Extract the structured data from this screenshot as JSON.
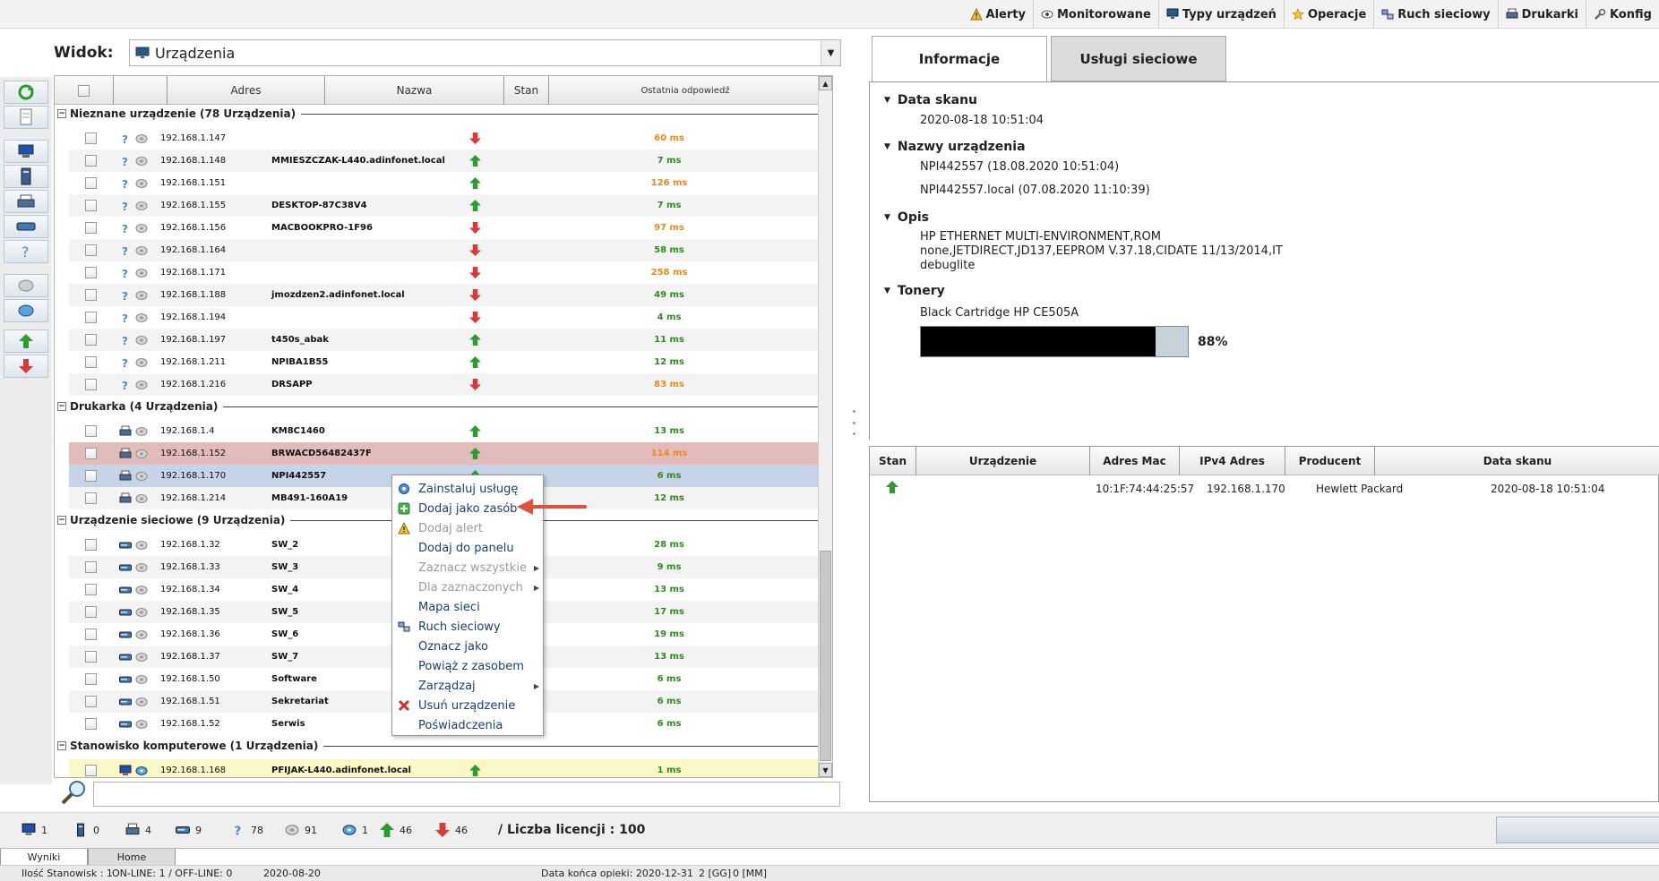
{
  "top_menu": [
    {
      "label": "Alerty",
      "icon": "warning-icon"
    },
    {
      "label": "Monitorowane",
      "icon": "eye-icon"
    },
    {
      "label": "Typy urządzeń",
      "icon": "monitor-icon"
    },
    {
      "label": "Operacje",
      "icon": "star-icon"
    },
    {
      "label": "Ruch sieciowy",
      "icon": "network-traffic-icon"
    },
    {
      "label": "Drukarki",
      "icon": "printer-icon"
    },
    {
      "label": "Konfig",
      "icon": "wrench-icon"
    }
  ],
  "view": {
    "label": "Widok:",
    "selected": "Urządzenia"
  },
  "grid": {
    "columns": {
      "address": "Adres",
      "name": "Nazwa",
      "status": "Stan",
      "last_response": "Ostatnia odpowiedź"
    },
    "groups": [
      {
        "title": "Nieznane urządzenie (78 Urządzenia)",
        "rows": [
          {
            "ip": "192.168.1.147",
            "name": "",
            "status": "down",
            "ms": "60 ms",
            "ms_color": "orange"
          },
          {
            "ip": "192.168.1.148",
            "name": "MMIESZCZAK-L440.adinfonet.local",
            "status": "up",
            "ms": "7 ms",
            "ms_color": "green"
          },
          {
            "ip": "192.168.1.151",
            "name": "",
            "status": "up",
            "ms": "126 ms",
            "ms_color": "orange"
          },
          {
            "ip": "192.168.1.155",
            "name": "DESKTOP-87C38V4",
            "status": "up",
            "ms": "7 ms",
            "ms_color": "green"
          },
          {
            "ip": "192.168.1.156",
            "name": "MACBOOKPRO-1F96",
            "status": "down",
            "ms": "97 ms",
            "ms_color": "orange"
          },
          {
            "ip": "192.168.1.164",
            "name": "",
            "status": "down",
            "ms": "58 ms",
            "ms_color": "green"
          },
          {
            "ip": "192.168.1.171",
            "name": "",
            "status": "down",
            "ms": "258 ms",
            "ms_color": "orange"
          },
          {
            "ip": "192.168.1.188",
            "name": "jmozdzen2.adinfonet.local",
            "status": "down",
            "ms": "49 ms",
            "ms_color": "green"
          },
          {
            "ip": "192.168.1.194",
            "name": "",
            "status": "down",
            "ms": "4 ms",
            "ms_color": "green"
          },
          {
            "ip": "192.168.1.197",
            "name": "t450s_abak",
            "status": "up",
            "ms": "11 ms",
            "ms_color": "green"
          },
          {
            "ip": "192.168.1.211",
            "name": "NPIBA1B55",
            "status": "up",
            "ms": "12 ms",
            "ms_color": "green"
          },
          {
            "ip": "192.168.1.216",
            "name": "DRSAPP",
            "status": "down",
            "ms": "83 ms",
            "ms_color": "orange"
          }
        ]
      },
      {
        "title": "Drukarka (4 Urządzenia)",
        "rows": [
          {
            "ip": "192.168.1.4",
            "name": "KM8C1460",
            "status": "up",
            "ms": "13 ms",
            "ms_color": "green"
          },
          {
            "ip": "192.168.1.152",
            "name": "BRWACD56482437F",
            "status": "up",
            "ms": "114 ms",
            "ms_color": "orange",
            "highlight": "red"
          },
          {
            "ip": "192.168.1.170",
            "name": "NPI442557",
            "status": "up",
            "ms": "6 ms",
            "ms_color": "green",
            "highlight": "blue"
          },
          {
            "ip": "192.168.1.214",
            "name": "MB491-160A19",
            "status": "up",
            "ms": "12 ms",
            "ms_color": "green"
          }
        ]
      },
      {
        "title": "Urządzenie sieciowe (9 Urządzenia)",
        "rows": [
          {
            "ip": "192.168.1.32",
            "name": "SW_2",
            "status": "",
            "ms": "28 ms",
            "ms_color": "green"
          },
          {
            "ip": "192.168.1.33",
            "name": "SW_3",
            "status": "",
            "ms": "9 ms",
            "ms_color": "green"
          },
          {
            "ip": "192.168.1.34",
            "name": "SW_4",
            "status": "",
            "ms": "13 ms",
            "ms_color": "green"
          },
          {
            "ip": "192.168.1.35",
            "name": "SW_5",
            "status": "",
            "ms": "17 ms",
            "ms_color": "green"
          },
          {
            "ip": "192.168.1.36",
            "name": "SW_6",
            "status": "",
            "ms": "19 ms",
            "ms_color": "green"
          },
          {
            "ip": "192.168.1.37",
            "name": "SW_7",
            "status": "",
            "ms": "13 ms",
            "ms_color": "green"
          },
          {
            "ip": "192.168.1.50",
            "name": "Software",
            "status": "",
            "ms": "6 ms",
            "ms_color": "green"
          },
          {
            "ip": "192.168.1.51",
            "name": "Sekretariat",
            "status": "",
            "ms": "6 ms",
            "ms_color": "green"
          },
          {
            "ip": "192.168.1.52",
            "name": "Serwis",
            "status": "",
            "ms": "6 ms",
            "ms_color": "green"
          }
        ]
      },
      {
        "title": "Stanowisko komputerowe (1 Urządzenia)",
        "rows": [
          {
            "ip": "192.168.1.168",
            "name": "PFIJAK-L440.adinfonet.local",
            "status": "up",
            "ms": "1 ms",
            "ms_color": "green",
            "highlight": "yellow"
          }
        ]
      }
    ]
  },
  "context_menu": [
    {
      "label": "Zainstaluj usługę",
      "icon": "gear-icon",
      "disabled": false,
      "submenu": false
    },
    {
      "label": "Dodaj jako zasób",
      "icon": "plus-icon",
      "disabled": false,
      "submenu": false
    },
    {
      "label": "Dodaj alert",
      "icon": "warning-icon",
      "disabled": true,
      "submenu": false
    },
    {
      "label": "Dodaj do panelu",
      "icon": "",
      "disabled": false,
      "submenu": false
    },
    {
      "label": "Zaznacz wszystkie",
      "icon": "",
      "disabled": true,
      "submenu": true
    },
    {
      "label": "Dla zaznaczonych",
      "icon": "",
      "disabled": true,
      "submenu": true
    },
    {
      "label": "Mapa sieci",
      "icon": "",
      "disabled": false,
      "submenu": false
    },
    {
      "label": "Ruch sieciowy",
      "icon": "network-traffic-icon",
      "disabled": false,
      "submenu": false
    },
    {
      "label": "Oznacz jako",
      "icon": "",
      "disabled": false,
      "submenu": false
    },
    {
      "label": "Powiąż z zasobem",
      "icon": "",
      "disabled": false,
      "submenu": false
    },
    {
      "label": "Zarządzaj",
      "icon": "",
      "disabled": false,
      "submenu": true
    },
    {
      "label": "Usuń urządzenie",
      "icon": "delete-icon",
      "disabled": false,
      "submenu": false
    },
    {
      "label": "Poświadczenia",
      "icon": "",
      "disabled": false,
      "submenu": false
    }
  ],
  "right_panel": {
    "tabs": [
      "Informacje",
      "Usługi sieciowe"
    ],
    "sections": {
      "scan_date_title": "Data skanu",
      "scan_date": "2020-08-18 10:51:04",
      "names_title": "Nazwy urządzenia",
      "name1": "NPI442557 (18.08.2020 10:51:04)",
      "name2": "NPI442557.local (07.08.2020 11:10:39)",
      "desc_title": "Opis",
      "desc1": "HP ETHERNET MULTI-ENVIRONMENT,ROM",
      "desc2": "none,JETDIRECT,JD137,EEPROM V.37.18,CIDATE 11/13/2014,IT",
      "desc3": "debuglite",
      "toners_title": "Tonery",
      "toner_name": "Black Cartridge HP CE505A",
      "toner_level": 0.88,
      "toner_pct": "88%"
    },
    "history": {
      "columns": [
        "Stan",
        "Urządzenie",
        "Adres Mac",
        "IPv4 Adres",
        "Producent",
        "Data skanu"
      ],
      "row": {
        "status": "up",
        "device": "",
        "mac": "10:1F:74:44:25:57",
        "ip": "192.168.1.170",
        "producer": "Hewlett Packard",
        "date": "2020-08-18 10:51:04"
      }
    }
  },
  "stats": [
    {
      "icon": "computer-icon",
      "value": "1"
    },
    {
      "icon": "server-icon",
      "value": "0"
    },
    {
      "icon": "printer-icon",
      "value": "4"
    },
    {
      "icon": "switch-icon",
      "value": "9"
    },
    {
      "icon": "unknown-device-icon",
      "value": "78"
    },
    {
      "icon": "gray-disk-icon",
      "value": "91"
    },
    {
      "icon": "blue-disk-icon",
      "value": "1"
    },
    {
      "icon": "arrow-up-icon",
      "value": "46"
    },
    {
      "icon": "arrow-down-icon",
      "value": "46"
    }
  ],
  "licence": "/     Liczba licencji : 100",
  "bottom_tabs": [
    "Wyniki",
    "Home"
  ],
  "footer": {
    "stations": "Ilość Stanowisk : 1",
    "online": "ON-LINE: 1 / OFF-LINE: 0",
    "date": "2020-08-20",
    "care_end": "Data końca opieki: 2020-12-31",
    "gg": "2 [GG]",
    "mm": "0 [MM]"
  },
  "colors": {
    "up": "#2e9b2e",
    "down": "#d83a3a",
    "accent": "#1d3d72"
  }
}
